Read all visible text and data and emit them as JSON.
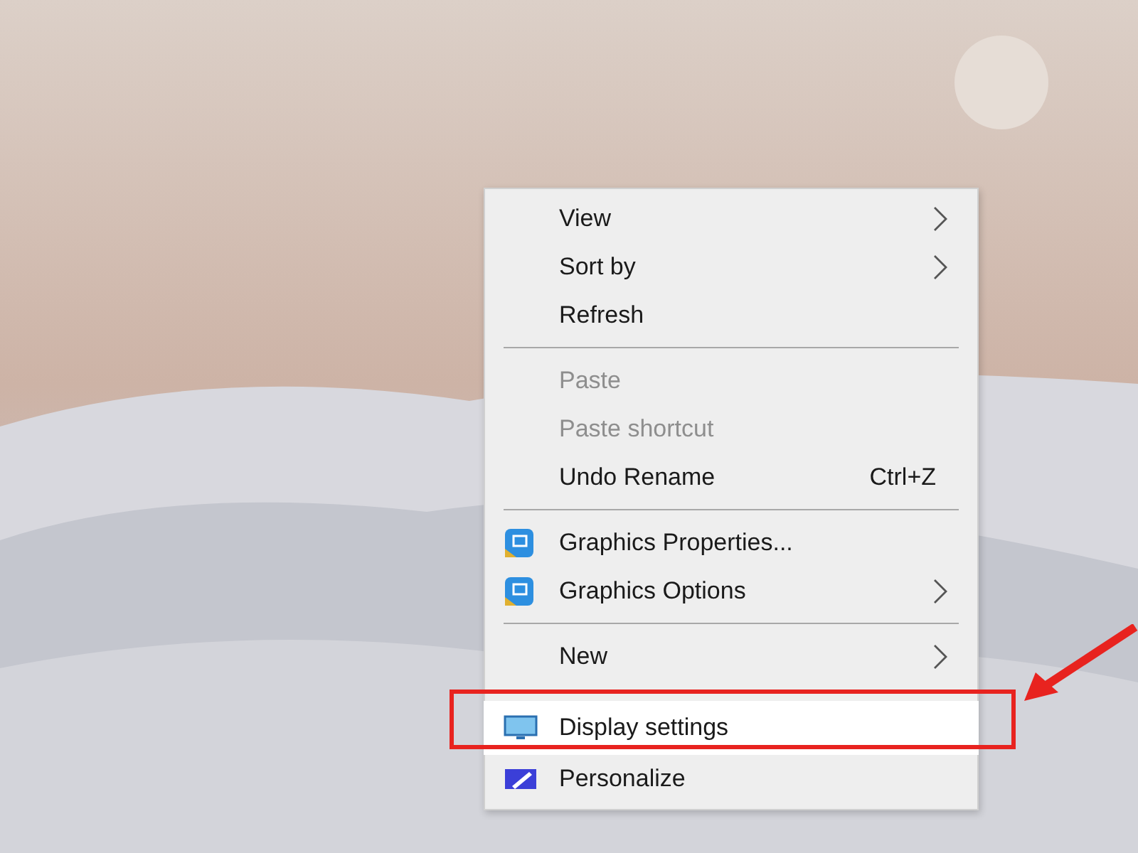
{
  "context_menu": {
    "groups": [
      [
        {
          "label": "View",
          "kind": "plain",
          "submenu": true,
          "disabled": false,
          "selected": false
        },
        {
          "label": "Sort by",
          "kind": "plain",
          "submenu": true,
          "disabled": false,
          "selected": false
        },
        {
          "label": "Refresh",
          "kind": "plain",
          "submenu": false,
          "disabled": false,
          "selected": false
        }
      ],
      [
        {
          "label": "Paste",
          "kind": "plain",
          "submenu": false,
          "disabled": true,
          "selected": false
        },
        {
          "label": "Paste shortcut",
          "kind": "plain",
          "submenu": false,
          "disabled": true,
          "selected": false
        },
        {
          "label": "Undo Rename",
          "kind": "plain",
          "shortcut": "Ctrl+Z",
          "submenu": false,
          "disabled": false,
          "selected": false
        }
      ],
      [
        {
          "label": "Graphics Properties...",
          "kind": "graphics",
          "submenu": false,
          "disabled": false,
          "selected": false
        },
        {
          "label": "Graphics Options",
          "kind": "graphics",
          "submenu": true,
          "disabled": false,
          "selected": false
        }
      ],
      [
        {
          "label": "New",
          "kind": "plain",
          "submenu": true,
          "disabled": false,
          "selected": false
        },
        {
          "label": "Display settings",
          "kind": "display",
          "submenu": false,
          "disabled": false,
          "selected": true
        },
        {
          "label": "Personalize",
          "kind": "personalize",
          "submenu": false,
          "disabled": false,
          "selected": false
        }
      ]
    ]
  }
}
